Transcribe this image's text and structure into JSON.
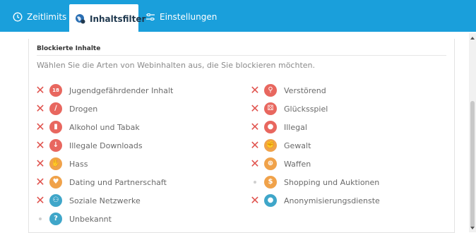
{
  "tabs": [
    {
      "label": "Zeitlimits",
      "icon": "clock-icon",
      "active": false
    },
    {
      "label": "Inhaltsfilter",
      "icon": "globe-filter-icon",
      "active": true
    },
    {
      "label": "Einstellungen",
      "icon": "sliders-icon",
      "active": false
    }
  ],
  "panel": {
    "title": "Blockierte Inhalte",
    "description": "Wählen Sie die Arten von Webinhalten aus, die Sie blockieren möchten."
  },
  "categories_left": [
    {
      "label": "Jugendgefährdender Inhalt",
      "blocked": true,
      "icon": "adult-18-icon",
      "color": "#e8675f"
    },
    {
      "label": "Drogen",
      "blocked": true,
      "icon": "drug-pill-icon",
      "color": "#e8675f"
    },
    {
      "label": "Alkohol und Tabak",
      "blocked": true,
      "icon": "bottle-icon",
      "color": "#e8675f"
    },
    {
      "label": "Illegale Downloads",
      "blocked": true,
      "icon": "download-icon",
      "color": "#e8675f"
    },
    {
      "label": "Hass",
      "blocked": true,
      "icon": "thumbs-down-icon",
      "color": "#f0a24a"
    },
    {
      "label": "Dating und Partnerschaft",
      "blocked": true,
      "icon": "heart-icon",
      "color": "#f0a24a"
    },
    {
      "label": "Soziale Netzwerke",
      "blocked": true,
      "icon": "people-icon",
      "color": "#3fa6c9"
    },
    {
      "label": "Unbekannt",
      "blocked": false,
      "icon": "question-icon",
      "color": "#3fa6c9"
    }
  ],
  "categories_right": [
    {
      "label": "Verstörend",
      "blocked": true,
      "icon": "knife-icon",
      "color": "#e8675f"
    },
    {
      "label": "Glücksspiel",
      "blocked": true,
      "icon": "dice-icon",
      "color": "#e8675f"
    },
    {
      "label": "Illegal",
      "blocked": true,
      "icon": "person-illegal-icon",
      "color": "#e8675f"
    },
    {
      "label": "Gewalt",
      "blocked": true,
      "icon": "fist-icon",
      "color": "#f0a24a"
    },
    {
      "label": "Waffen",
      "blocked": true,
      "icon": "crosshair-icon",
      "color": "#f0a24a"
    },
    {
      "label": "Shopping und Auktionen",
      "blocked": false,
      "icon": "dollar-icon",
      "color": "#f0a24a"
    },
    {
      "label": "Anonymisierungsdienste",
      "blocked": true,
      "icon": "anonymous-person-icon",
      "color": "#3fa6c9"
    }
  ],
  "glyphs": {
    "adult-18-icon": "18",
    "drug-pill-icon": "∕",
    "bottle-icon": "▮",
    "download-icon": "↓",
    "thumbs-down-icon": "✋",
    "heart-icon": "♥",
    "people-icon": "⚇",
    "question-icon": "?",
    "knife-icon": "⚲",
    "dice-icon": "⚄",
    "person-illegal-icon": "●",
    "fist-icon": "✊",
    "crosshair-icon": "⊕",
    "dollar-icon": "$",
    "anonymous-person-icon": "●"
  },
  "blocked_mark": "✕",
  "colors": {
    "accent": "#1a9fdb",
    "blocked": "#e0524d"
  }
}
